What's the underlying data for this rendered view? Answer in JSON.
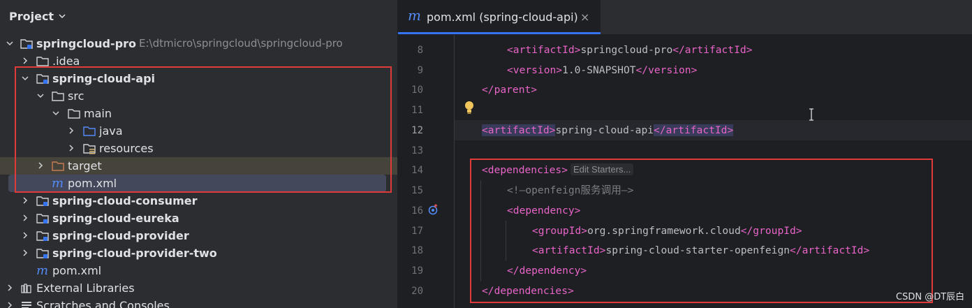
{
  "project_panel": {
    "title": "Project",
    "rows": [
      {
        "label": "springcloud-pro",
        "path": "E:\\dtmicro\\springcloud\\springcloud-pro"
      },
      {
        "label": ".idea"
      },
      {
        "label": "spring-cloud-api"
      },
      {
        "label": "src"
      },
      {
        "label": "main"
      },
      {
        "label": "java"
      },
      {
        "label": "resources"
      },
      {
        "label": "target"
      },
      {
        "label": "pom.xml"
      },
      {
        "label": "spring-cloud-consumer"
      },
      {
        "label": "spring-cloud-eureka"
      },
      {
        "label": "spring-cloud-provider"
      },
      {
        "label": "spring-cloud-provider-two"
      },
      {
        "label": "pom.xml"
      },
      {
        "label": "External Libraries"
      },
      {
        "label": "Scratches and Consoles"
      }
    ],
    "maven_icon_glyph": "m"
  },
  "editor": {
    "tab": {
      "icon_glyph": "m",
      "label": "pom.xml (spring-cloud-api)",
      "close": "×"
    },
    "line_numbers": [
      "8",
      "9",
      "10",
      "11",
      "12",
      "13",
      "14",
      "15",
      "16",
      "17",
      "18",
      "19",
      "20"
    ],
    "lines": {
      "l8": {
        "open": "<artifactId>",
        "text": "springcloud-pro",
        "close": "</artifactId>"
      },
      "l9": {
        "open": "<version>",
        "text": "1.0-SNAPSHOT",
        "close": "</version>"
      },
      "l10": {
        "close": "</parent>"
      },
      "l12": {
        "open": "<artifactId>",
        "text": "spring-cloud-api",
        "close": "</artifactId>"
      },
      "l14": {
        "open": "<dependencies>",
        "hint": "Edit Starters..."
      },
      "l15": {
        "comment": "<!—openfeign服务调用—>"
      },
      "l16": {
        "open": "<dependency>"
      },
      "l17": {
        "open": "<groupId>",
        "text": "org.springframework.cloud",
        "close": "</groupId>"
      },
      "l18": {
        "open": "<artifactId>",
        "text": "spring-cloud-starter-openfeign",
        "close": "</artifactId>"
      },
      "l19": {
        "close": "</dependency>"
      },
      "l20": {
        "close": "</dependencies>"
      }
    }
  },
  "watermark": "CSDN @DT辰白",
  "colors": {
    "tag": "#e864c8",
    "highlight_box": "#e03a3a",
    "accent": "#3574f0",
    "folder_orange": "#c77d54"
  }
}
